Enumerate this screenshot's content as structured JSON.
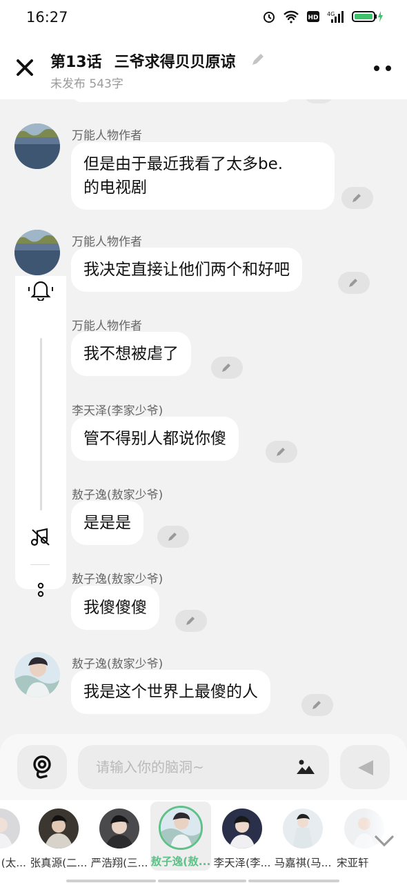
{
  "status_bar": {
    "time": "16:27"
  },
  "header": {
    "title": "第13话",
    "subtitle": "三爷求得贝贝原谅",
    "meta": "未发布 543字"
  },
  "messages": [
    {
      "name": "万能人物作者",
      "lines": [
        "但是由于最近我看了太多be.",
        "的电视剧"
      ]
    },
    {
      "name": "万能人物作者",
      "lines": [
        "我决定直接让他们两个和好吧"
      ]
    },
    {
      "name": "万能人物作者",
      "lines": [
        "我不想被虐了"
      ]
    },
    {
      "name": "李天泽(李家少爷)",
      "lines": [
        "管不得别人都说你傻"
      ]
    },
    {
      "name": "敖子逸(敖家少爷)",
      "lines": [
        "是是是"
      ]
    },
    {
      "name": "敖子逸(敖家少爷)",
      "lines": [
        "我傻傻傻"
      ]
    },
    {
      "name": "敖子逸(敖家少爷)",
      "lines": [
        "我是这个世界上最傻的人"
      ]
    }
  ],
  "input": {
    "placeholder": "请输入你的脑洞~"
  },
  "characters": [
    {
      "label": "(太..."
    },
    {
      "label": "张真源(二..."
    },
    {
      "label": "严浩翔(三..."
    },
    {
      "label": "敖子逸(敖..."
    },
    {
      "label": "李天泽(李..."
    },
    {
      "label": "马嘉祺(马..."
    },
    {
      "label": "宋亚轩"
    }
  ],
  "colors": {
    "accent": "#5fc088",
    "bubble": "#ffffff",
    "background": "#f2f2f2"
  },
  "icons": [
    "close-icon",
    "pencil-icon",
    "more-icon",
    "bell-icon",
    "music-icon",
    "dots-icon",
    "voice-icon",
    "image-icon",
    "send-icon",
    "chevron-down-icon"
  ]
}
